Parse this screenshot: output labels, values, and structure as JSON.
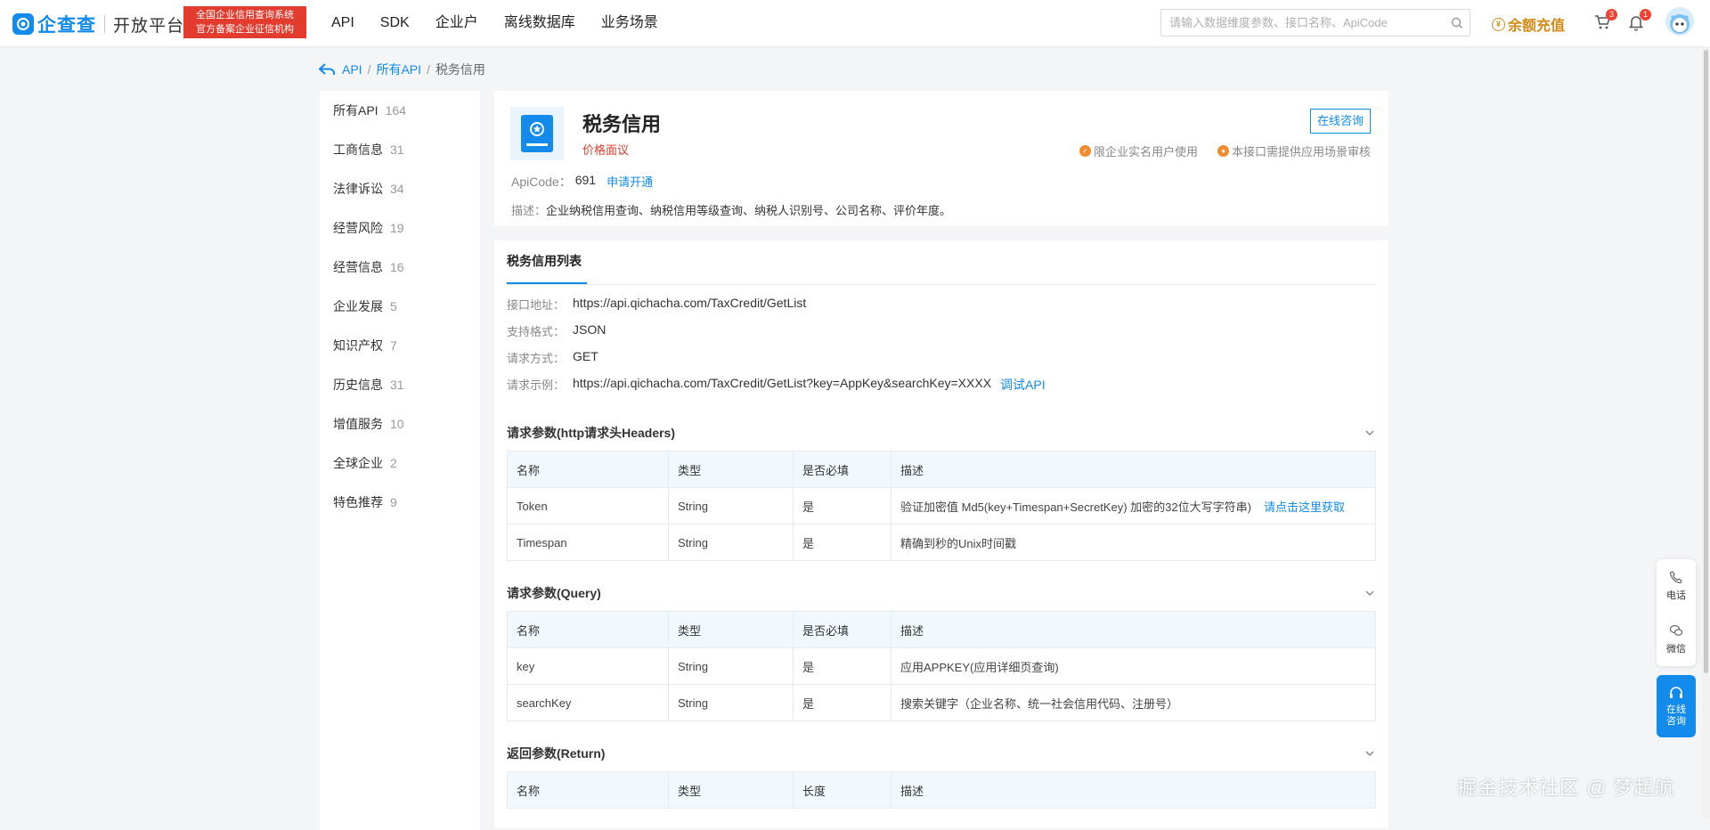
{
  "brand": {
    "logo_text": "企查查",
    "sub_text": "开放平台",
    "cert_line1": "全国企业信用查询系统",
    "cert_line2": "官方备案企业征信机构"
  },
  "nav": [
    "API",
    "SDK",
    "企业户",
    "离线数据库",
    "业务场景"
  ],
  "search": {
    "placeholder": "请输入数据维度参数、接口名称、ApiCode"
  },
  "header": {
    "recharge_label": "余额充值",
    "cart_count": "3",
    "bell_count": "1"
  },
  "breadcrumb": {
    "root": "API",
    "sep1": "/",
    "mid": "所有API",
    "sep2": "/",
    "current": "税务信用"
  },
  "sidebar": [
    {
      "label": "所有API",
      "count": "164"
    },
    {
      "label": "工商信息",
      "count": "31"
    },
    {
      "label": "法律诉讼",
      "count": "34"
    },
    {
      "label": "经营风险",
      "count": "19"
    },
    {
      "label": "经营信息",
      "count": "16"
    },
    {
      "label": "企业发展",
      "count": "5"
    },
    {
      "label": "知识产权",
      "count": "7"
    },
    {
      "label": "历史信息",
      "count": "31"
    },
    {
      "label": "增值服务",
      "count": "10"
    },
    {
      "label": "全球企业",
      "count": "2"
    },
    {
      "label": "特色推荐",
      "count": "9"
    }
  ],
  "api": {
    "title": "税务信用",
    "price": "价格面议",
    "consult_label": "在线咨询",
    "tag1": "限企业实名用户使用",
    "tag2": "本接口需提供应用场景审核",
    "apicode_label": "ApiCode：",
    "apicode_value": "691",
    "apply_label": "申请开通",
    "desc_label": "描述：",
    "desc_value": "企业纳税信用查询、纳税信用等级查询、纳税人识别号、公司名称、评价年度。"
  },
  "detail": {
    "tab": "税务信用列表",
    "url_label": "接口地址：",
    "url_value": "https://api.qichacha.com/TaxCredit/GetList",
    "format_label": "支持格式：",
    "format_value": "JSON",
    "method_label": "请求方式：",
    "method_value": "GET",
    "example_label": "请求示例：",
    "example_value": "https://api.qichacha.com/TaxCredit/GetList?key=AppKey&searchKey=XXXX",
    "debug_label": "调试API"
  },
  "headers_section": {
    "title": "请求参数(http请求头Headers)",
    "columns": [
      "名称",
      "类型",
      "是否必填",
      "描述"
    ],
    "rows": [
      {
        "name": "Token",
        "type": "String",
        "required": "是",
        "desc": "验证加密值 Md5(key+Timespan+SecretKey) 加密的32位大写字符串)",
        "link": "请点击这里获取"
      },
      {
        "name": "Timespan",
        "type": "String",
        "required": "是",
        "desc": "精确到秒的Unix时间戳",
        "link": ""
      }
    ]
  },
  "query_section": {
    "title": "请求参数(Query)",
    "columns": [
      "名称",
      "类型",
      "是否必填",
      "描述"
    ],
    "rows": [
      {
        "name": "key",
        "type": "String",
        "required": "是",
        "desc": "应用APPKEY(应用详细页查询)"
      },
      {
        "name": "searchKey",
        "type": "String",
        "required": "是",
        "desc": "搜索关键字（企业名称、统一社会信用代码、注册号）"
      }
    ]
  },
  "return_section": {
    "title": "返回参数(Return)",
    "columns": [
      "名称",
      "类型",
      "长度",
      "描述"
    ]
  },
  "float": {
    "phone": "电话",
    "wechat": "微信",
    "online_1": "在线",
    "online_2": "咨询"
  },
  "watermark": "掘金技术社区 @ 梦起航",
  "colors": {
    "brand_blue": "#128bed",
    "cert_red": "#e33b2e",
    "recharge_gold": "#d28c16"
  }
}
